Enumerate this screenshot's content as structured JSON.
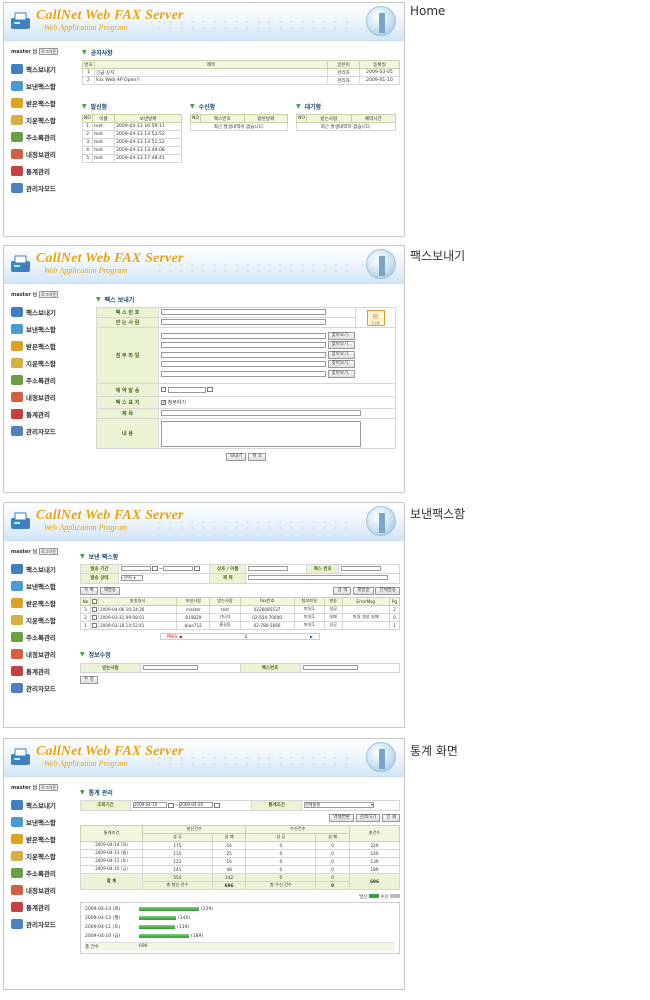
{
  "banner": {
    "title": "CallNet Web FAX Server",
    "subtitle": "Web Application Program"
  },
  "labels": {
    "home": "Home",
    "send": "팩스보내기",
    "sent": "보낸팩스함",
    "stats": "통계 화면"
  },
  "user": {
    "name": "master 님",
    "logout": "로그아웃"
  },
  "menu": [
    "팩스보내기",
    "보낸팩스함",
    "받은팩스함",
    "지운팩스함",
    "주소록관리",
    "내정보관리",
    "통계관리",
    "관리자모드"
  ],
  "menu_icon_colors": [
    "#3f7fc4",
    "#4a9ad6",
    "#e0a020",
    "#d8b040",
    "#6aa040",
    "#d06040",
    "#c44040",
    "#5080c0"
  ],
  "home": {
    "notice": {
      "title": "공지사항",
      "headers": [
        "번호",
        "제목",
        "글쓴이",
        "등록일"
      ],
      "rows": [
        [
          "1",
          "긴급 공지",
          "관리자",
          "2009-03-05"
        ],
        [
          "2",
          "Fax Web AP Open!!",
          "관리자",
          "2009-01-10"
        ]
      ]
    },
    "sent": {
      "title": "발신함",
      "headers": [
        "NO",
        "이름",
        "보낸날짜"
      ],
      "rows": [
        [
          "1",
          "test",
          "2009-04-13 16:59:11"
        ],
        [
          "2",
          "test",
          "2009-04-13 13:53:52"
        ],
        [
          "3",
          "test",
          "2009-04-13 13:51:22"
        ],
        [
          "4",
          "test",
          "2009-04-13 13:49:08"
        ],
        [
          "5",
          "test",
          "2009-04-13 17:48:41"
        ]
      ]
    },
    "received": {
      "title": "수신함",
      "headers": [
        "NO",
        "팩스번호",
        "받은날짜"
      ],
      "empty": "최근 발생내역이 없습니다."
    },
    "waiting": {
      "title": "대기함",
      "headers": [
        "NO",
        "받는사람",
        "예약시간"
      ],
      "empty": "최근 발생내역이 없습니다."
    }
  },
  "send": {
    "title": "팩스 보내기",
    "fax_number": "팩 스 번 호",
    "receiver": "받 는 사 람",
    "addressbook": "주소록",
    "attach": "첨 부 파 일",
    "browse": "찾아보기..",
    "reserve": "예 약 발 송",
    "cover": "팩 스 표 지",
    "cover_check": "첨부하기",
    "subject": "제 목",
    "body": "내 용",
    "send_btn": "보내기",
    "cancel_btn": "취 소"
  },
  "sentbox": {
    "title": "보낸 팩스함",
    "filter": {
      "period": "발송 기간",
      "company": "상호 / 이름",
      "faxno": "팩스 번호",
      "status": "발송 상태",
      "select": "-선택-",
      "subject": "제 목"
    },
    "search_btn": "검 색",
    "resend_btn": "재발송",
    "bulk_btn": "전체발송",
    "list_btn": "목 록",
    "redo_btn": "재발송",
    "headers": [
      "No",
      "",
      "발송일시",
      "보낸사람",
      "받는사람",
      "Fax번호",
      "첨부파일",
      "발송",
      "ErrorMsg",
      "Pg"
    ],
    "rows": [
      [
        "3",
        "",
        "2009-04-06 10:24:26",
        "master",
        "test",
        "0226085537",
        "파일1",
        "성공",
        "",
        "2"
      ],
      [
        "2",
        "",
        "2009-03-31 09:08:01",
        "810829",
        "가나다",
        "02-554-70000",
        "파일1",
        "실패",
        "파일 생성 실패",
        "0"
      ],
      [
        "1",
        "",
        "2009-03-18 14:52:41",
        "blue712",
        "홍길동",
        "02-780-5666",
        "파일1",
        "성공",
        "",
        "1"
      ]
    ],
    "pager": {
      "prev": "PREV ◀",
      "current": "1",
      "next": "▶"
    },
    "edit": {
      "title": "정보수정",
      "receiver": "받는사람",
      "faxno": "팩스번호",
      "edit_btn": "수 정"
    }
  },
  "stats": {
    "title": "통계 관리",
    "period_label": "조회기간",
    "date_from": "2009-04-10",
    "date_to": "2009-04-20",
    "cond_label": "통계조건",
    "cond_value": "전체통계",
    "btns": [
      "엑셀변환",
      "검색하기",
      "인 쇄"
    ],
    "headers": {
      "date": "통계조건",
      "send": "발신건수",
      "recv": "수신건수",
      "total": "총건수",
      "ok": "성 공",
      "fail": "실 패"
    },
    "rows": [
      [
        "2009-04-14 (화)",
        "175",
        "54",
        "0",
        "0",
        "229"
      ],
      [
        "2009-04-13 (월)",
        "115",
        "25",
        "0",
        "0",
        "140"
      ],
      [
        "2009-04-11 (토)",
        "123",
        "16",
        "0",
        "0",
        "139"
      ],
      [
        "2009-04-10 (금)",
        "141",
        "48",
        "0",
        "0",
        "189"
      ]
    ],
    "sum": {
      "label": "합 계",
      "send_ok": "554",
      "send_fail": "142",
      "recv_ok": "0",
      "recv_fail": "0",
      "total": "696",
      "send_total_label": "총 발신 건수",
      "send_total": "696",
      "recv_total_label": "총 수신 건수",
      "recv_total": "0"
    },
    "legend": {
      "send": "발신",
      "recv": "수신"
    },
    "bars": [
      {
        "date": "2009-04-14 (화)",
        "label": "(229)",
        "value": 229
      },
      {
        "date": "2009-04-13 (월)",
        "label": "(140)",
        "value": 140
      },
      {
        "date": "2009-04-11 (토)",
        "label": "(139)",
        "value": 139
      },
      {
        "date": "2009-04-10 (금)",
        "label": "(189)",
        "value": 189
      }
    ],
    "total_label": "총 건수",
    "total_value": "696"
  }
}
